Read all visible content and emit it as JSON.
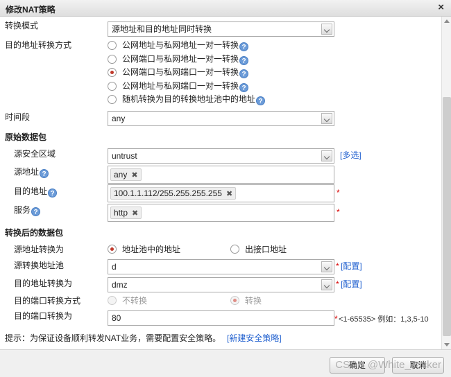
{
  "dialog": {
    "title": "修改NAT策略",
    "close": "×"
  },
  "mode": {
    "label": "转换模式",
    "value": "源地址和目的地址同时转换"
  },
  "dst_method": {
    "label": "目的地址转换方式",
    "options": [
      {
        "text": "公网地址与私网地址一对一转换",
        "selected": false
      },
      {
        "text": "公网端口与私网地址一对一转换",
        "selected": false
      },
      {
        "text": "公网端口与私网端口一对一转换",
        "selected": true
      },
      {
        "text": "公网地址与私网端口一对一转换",
        "selected": false
      },
      {
        "text": "随机转换为目的转换地址池中的地址",
        "selected": false
      }
    ]
  },
  "time": {
    "label": "时间段",
    "value": "any"
  },
  "original": {
    "heading": "原始数据包",
    "src_zone": {
      "label": "源安全区域",
      "value": "untrust",
      "link": "[多选]"
    },
    "src_addr": {
      "label": "源地址",
      "tag": "any"
    },
    "dst_addr": {
      "label": "目的地址",
      "tag": "100.1.1.112/255.255.255.255",
      "required": "*"
    },
    "service": {
      "label": "服务",
      "tag": "http",
      "required": "*"
    }
  },
  "translated": {
    "heading": "转换后的数据包",
    "src_translate": {
      "label": "源地址转换为",
      "opt_pool": "地址池中的地址",
      "opt_iface": "出接口地址"
    },
    "src_pool": {
      "label": "源转换地址池",
      "value": "d",
      "required": "*",
      "link": "[配置]"
    },
    "dst_translate": {
      "label": "目的地址转换为",
      "value": "dmz",
      "required": "*",
      "link": "[配置]"
    },
    "dst_port_method": {
      "label": "目的端口转换方式",
      "opt_no": "不转换",
      "opt_yes": "转换"
    },
    "dst_port": {
      "label": "目的端口转换为",
      "value": "80",
      "hint": "<1-65535> 例如：1,3,5-10",
      "required": "*"
    }
  },
  "tip": {
    "text": "提示：为保证设备顺利转发NAT业务，需要配置安全策略。",
    "link": "[新建安全策略]"
  },
  "help_glyph": "?",
  "buttons": {
    "ok": "确定",
    "cancel": "取消"
  },
  "watermark": "CSDN @White_Jacker"
}
